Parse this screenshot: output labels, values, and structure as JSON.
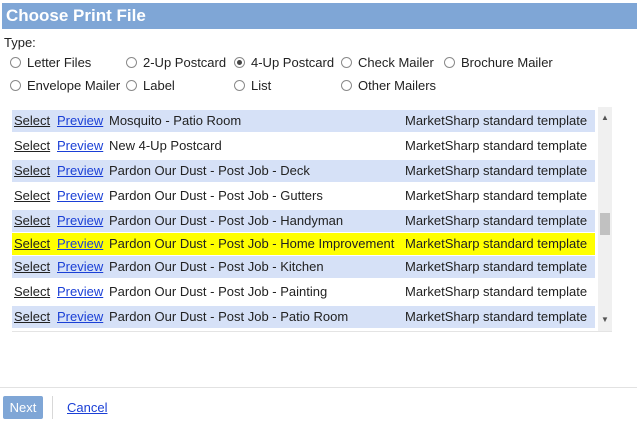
{
  "dialog": {
    "title": "Choose Print File"
  },
  "type_section": {
    "label": "Type:",
    "options": [
      {
        "label": "Letter Files",
        "checked": false
      },
      {
        "label": "2-Up Postcard",
        "checked": false
      },
      {
        "label": "4-Up Postcard",
        "checked": true
      },
      {
        "label": "Check Mailer",
        "checked": false
      },
      {
        "label": "Brochure Mailer",
        "checked": false
      },
      {
        "label": "Envelope Mailer",
        "checked": false
      },
      {
        "label": "Label",
        "checked": false
      },
      {
        "label": "List",
        "checked": false
      },
      {
        "label": "Other Mailers",
        "checked": false
      }
    ]
  },
  "file_list": {
    "select_label": "Select",
    "preview_label": "Preview",
    "rows": [
      {
        "name": "Mosquito - Patio Room",
        "template": "MarketSharp standard template",
        "highlighted": false
      },
      {
        "name": "New 4-Up Postcard",
        "template": "MarketSharp standard template",
        "highlighted": false
      },
      {
        "name": "Pardon Our Dust - Post Job - Deck",
        "template": "MarketSharp standard template",
        "highlighted": false
      },
      {
        "name": "Pardon Our Dust - Post Job - Gutters",
        "template": "MarketSharp standard template",
        "highlighted": false
      },
      {
        "name": "Pardon Our Dust - Post Job - Handyman",
        "template": "MarketSharp standard template",
        "highlighted": false
      },
      {
        "name": "Pardon Our Dust - Post Job - Home Improvement",
        "template": "MarketSharp standard template",
        "highlighted": true
      },
      {
        "name": "Pardon Our Dust - Post Job - Kitchen",
        "template": "MarketSharp standard template",
        "highlighted": false
      },
      {
        "name": "Pardon Our Dust - Post Job - Painting",
        "template": "MarketSharp standard template",
        "highlighted": false
      },
      {
        "name": "Pardon Our Dust - Post Job - Patio Room",
        "template": "MarketSharp standard template",
        "highlighted": false
      }
    ]
  },
  "footer": {
    "next_label": "Next",
    "cancel_label": "Cancel"
  },
  "colors": {
    "title_bar": "#7fa6d6",
    "row_alt": "#d6e1f7",
    "highlight": "#ffff00",
    "link": "#1a3fd6"
  },
  "icons": {
    "scroll_up": "scroll-up-arrow-icon",
    "scroll_down": "scroll-down-arrow-icon"
  }
}
